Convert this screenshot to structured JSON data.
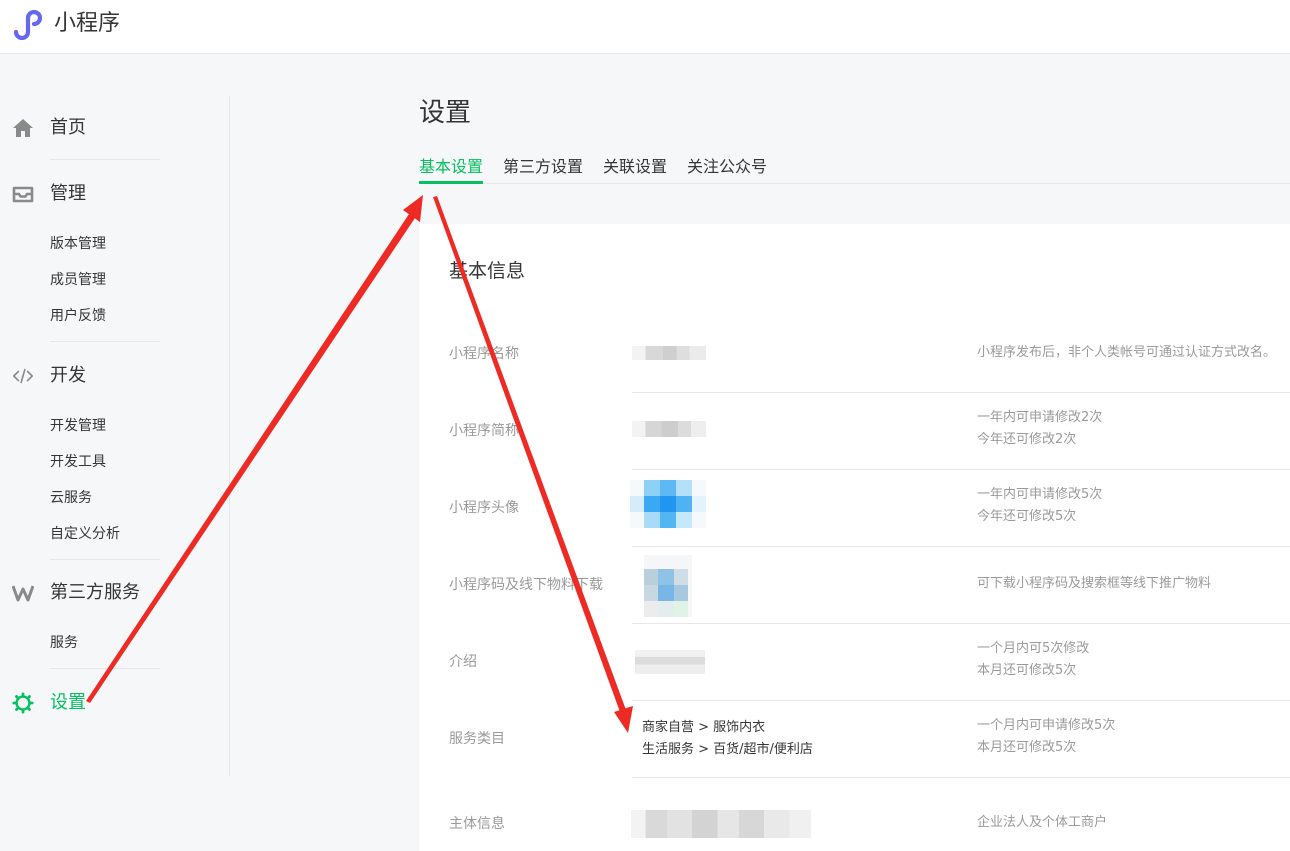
{
  "header": {
    "app_title": "小程序",
    "logo_icon": "mini-program-logo-icon",
    "logo_color": "#6467f0"
  },
  "sidebar": {
    "items": [
      {
        "label": "首页",
        "icon": "home-icon"
      },
      {
        "label": "管理",
        "icon": "inbox-icon",
        "children": [
          "版本管理",
          "成员管理",
          "用户反馈"
        ]
      },
      {
        "label": "开发",
        "icon": "code-icon",
        "children": [
          "开发管理",
          "开发工具",
          "云服务",
          "自定义分析"
        ]
      },
      {
        "label": "第三方服务",
        "icon": "third-party-icon",
        "children": [
          "服务"
        ]
      },
      {
        "label": "设置",
        "icon": "gear-icon",
        "active": true
      }
    ],
    "active_color": "#07c160"
  },
  "main": {
    "page_title": "设置",
    "tabs": [
      {
        "label": "基本设置",
        "active": true
      },
      {
        "label": "第三方设置"
      },
      {
        "label": "关联设置"
      },
      {
        "label": "关注公众号"
      }
    ],
    "section_title": "基本信息",
    "rows": [
      {
        "label": "小程序名称",
        "desc": [
          "小程序发布后，非个人类帐号可通过认证方式改名。"
        ]
      },
      {
        "label": "小程序简称",
        "desc": [
          "一年内可申请修改2次",
          "今年还可修改2次"
        ]
      },
      {
        "label": "小程序头像",
        "desc": [
          "一年内可申请修改5次",
          "今年还可修改5次"
        ]
      },
      {
        "label": "小程序码及线下物料下载",
        "desc": [
          "可下载小程序码及搜索框等线下推广物料"
        ]
      },
      {
        "label": "介绍",
        "desc": [
          "一个月内可5次修改",
          "本月还可修改5次"
        ]
      },
      {
        "label": "服务类目",
        "desc": [
          "一个月内可申请修改5次",
          "本月还可修改5次"
        ],
        "categories": [
          "商家自营 > 服饰内衣",
          "生活服务 > 百货/超市/便利店"
        ]
      },
      {
        "label": "主体信息",
        "desc": [
          "企业法人及个体工商户"
        ]
      }
    ]
  },
  "annotation_color": "#ee2a24"
}
